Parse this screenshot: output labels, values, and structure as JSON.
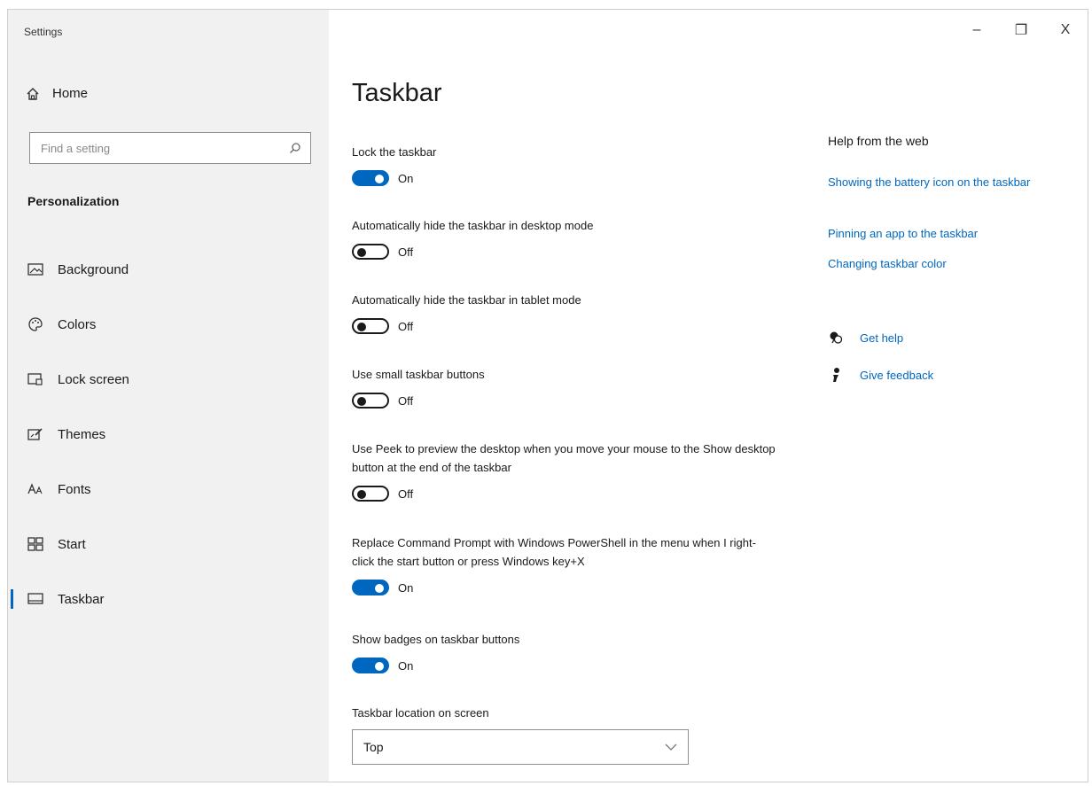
{
  "window": {
    "title": "Settings",
    "controls": {
      "minimize": "–",
      "restore": "❐",
      "close": "X"
    }
  },
  "sidebar": {
    "home": "Home",
    "search_placeholder": "Find a setting",
    "section": "Personalization",
    "items": [
      {
        "label": "Background",
        "icon": "background-icon"
      },
      {
        "label": "Colors",
        "icon": "palette-icon"
      },
      {
        "label": "Lock screen",
        "icon": "lock-screen-icon"
      },
      {
        "label": "Themes",
        "icon": "themes-icon"
      },
      {
        "label": "Fonts",
        "icon": "fonts-icon"
      },
      {
        "label": "Start",
        "icon": "start-icon"
      },
      {
        "label": "Taskbar",
        "icon": "taskbar-icon",
        "active": true
      }
    ]
  },
  "main": {
    "title": "Taskbar",
    "settings": [
      {
        "label": "Lock the taskbar",
        "state": "On"
      },
      {
        "label": "Automatically hide the taskbar in desktop mode",
        "state": "Off"
      },
      {
        "label": "Automatically hide the taskbar in tablet mode",
        "state": "Off"
      },
      {
        "label": "Use small taskbar buttons",
        "state": "Off"
      },
      {
        "label": "Use Peek to preview the desktop when you move your mouse to the Show desktop button at the end of the taskbar",
        "state": "Off"
      },
      {
        "label": "Replace Command Prompt with Windows PowerShell in the menu when I right-click the start button or press Windows key+X",
        "state": "On"
      },
      {
        "label": "Show badges on taskbar buttons",
        "state": "On"
      }
    ],
    "location_label": "Taskbar location on screen",
    "location_value": "Top"
  },
  "help": {
    "title": "Help from the web",
    "links": [
      "Showing the battery icon on the taskbar",
      "Pinning an app to the taskbar",
      "Changing taskbar color"
    ],
    "get_help": "Get help",
    "give_feedback": "Give feedback"
  },
  "colors": {
    "accent": "#0067c0",
    "sidebar_bg": "#f1f1f1"
  }
}
